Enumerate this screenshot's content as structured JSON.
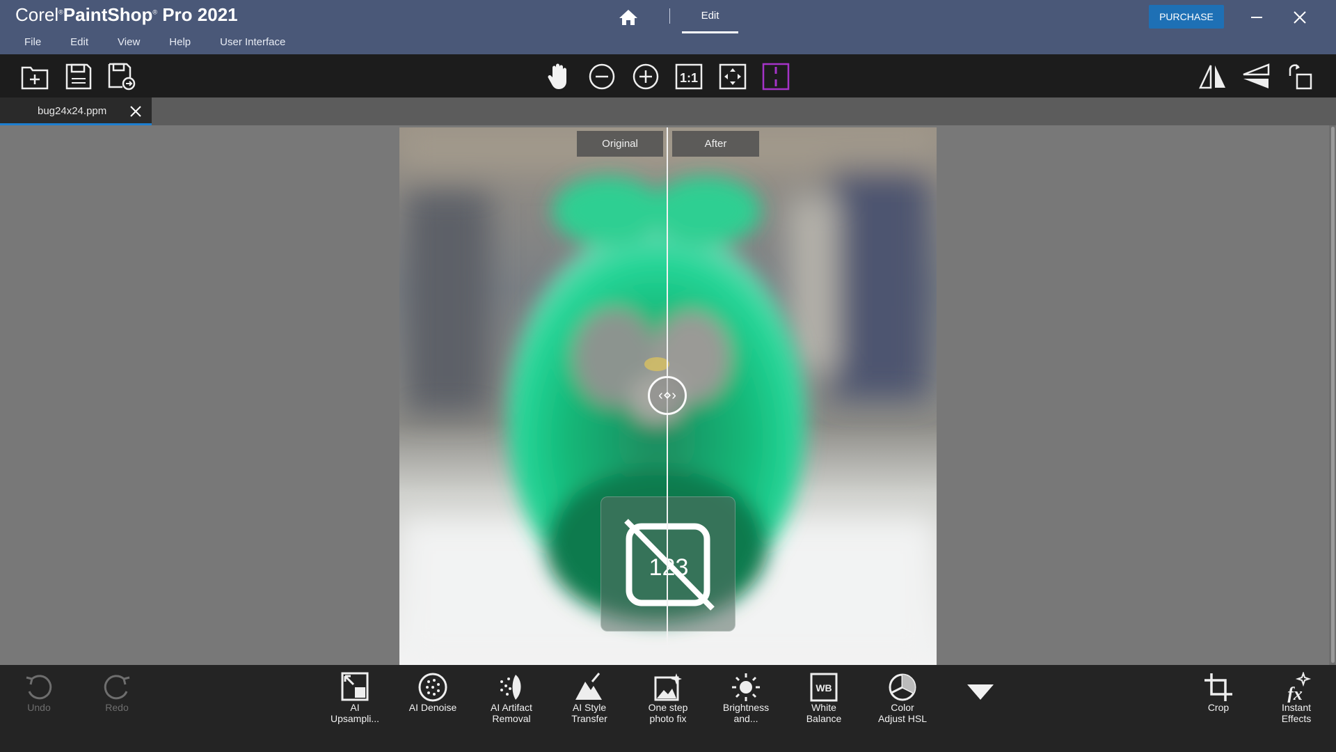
{
  "app": {
    "brand_corel": "Corel",
    "brand_product": "PaintShop",
    "brand_pro": " Pro 2021"
  },
  "menu": [
    "File",
    "Edit",
    "View",
    "Help",
    "User Interface"
  ],
  "workspace_tab": "Edit",
  "purchase_label": "PURCHASE",
  "document_tab": "bug24x24.ppm",
  "compare": {
    "original": "Original",
    "after": "After"
  },
  "colors": {
    "titlebar": "#4a5878",
    "accent": "#1e70b5",
    "toolbar": "#1c1c1c",
    "active_view": "#a533c8"
  },
  "bottom_tools": [
    {
      "label": "Undo",
      "icon": "undo-icon",
      "enabled": false
    },
    {
      "label": "Redo",
      "icon": "redo-icon",
      "enabled": false
    },
    {
      "label": "AI Upsampli...",
      "icon": "ai-upsampling-icon",
      "enabled": true
    },
    {
      "label": "AI Denoise",
      "icon": "ai-denoise-icon",
      "enabled": true
    },
    {
      "label": "AI Artifact Removal",
      "icon": "ai-artifact-icon",
      "enabled": true
    },
    {
      "label": "AI Style Transfer",
      "icon": "ai-style-icon",
      "enabled": true
    },
    {
      "label": "One step photo fix",
      "icon": "photo-fix-icon",
      "enabled": true
    },
    {
      "label": "Brightness and...",
      "icon": "brightness-icon",
      "enabled": true
    },
    {
      "label": "White Balance",
      "icon": "white-balance-icon",
      "enabled": true
    },
    {
      "label": "Color Adjust HSL",
      "icon": "color-hsl-icon",
      "enabled": true
    },
    {
      "label": "Crop",
      "icon": "crop-icon",
      "enabled": true
    },
    {
      "label": "Instant Effects",
      "icon": "instant-effects-icon",
      "enabled": true
    }
  ],
  "labels": {
    "ai_up_1": "AI",
    "ai_up_2": "Upsampli...",
    "ai_denoise": "AI Denoise",
    "ai_art_1": "AI Artifact",
    "ai_art_2": "Removal",
    "ai_style_1": "AI Style",
    "ai_style_2": "Transfer",
    "onestep_1": "One step",
    "onestep_2": "photo fix",
    "bright_1": "Brightness",
    "bright_2": "and...",
    "wb_1": "White",
    "wb_2": "Balance",
    "hsl_1": "Color",
    "hsl_2": "Adjust HSL",
    "undo": "Undo",
    "redo": "Redo",
    "crop": "Crop",
    "fx_1": "Instant",
    "fx_2": "Effects",
    "wb_glyph": "WB",
    "one_to_one": "1:1",
    "numbers_glyph": "123"
  }
}
